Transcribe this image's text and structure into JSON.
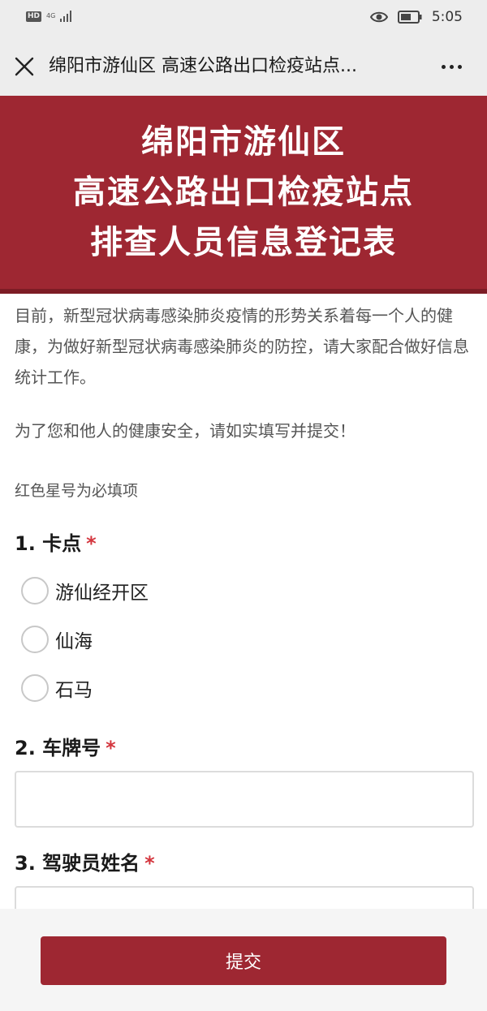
{
  "status_bar": {
    "hd_badge": "HD",
    "network": "4G",
    "time": "5:05"
  },
  "nav": {
    "title": "绵阳市游仙区 高速公路出口检疫站点..."
  },
  "banner": {
    "line1": "绵阳市游仙区",
    "line2": "高速公路出口检疫站点",
    "line3": "排查人员信息登记表"
  },
  "intro": "目前，新型冠状病毒感染肺炎疫情的形势关系着每一个人的健康，为做好新型冠状病毒感染肺炎的防控，请大家配合做好信息统计工作。",
  "notice": "为了您和他人的健康安全，请如实填写并提交！",
  "required_hint": "红色星号为必填项",
  "questions": {
    "q1": {
      "title": "1. 卡点",
      "star": "*",
      "options": [
        "游仙经开区",
        "仙海",
        "石马"
      ]
    },
    "q2": {
      "title": "2. 车牌号",
      "star": "*",
      "value": ""
    },
    "q3": {
      "title": "3. 驾驶员姓名",
      "star": "*",
      "value": ""
    }
  },
  "submit_label": "提交",
  "colors": {
    "accent": "#9e2732",
    "required_star": "#d4363e"
  }
}
